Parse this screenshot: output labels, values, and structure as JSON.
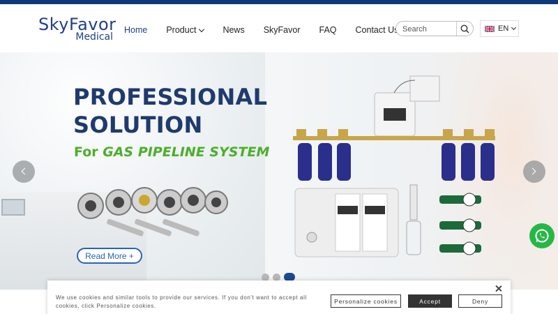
{
  "brand": {
    "logo_main": "SkyFavor",
    "logo_sub": "Medical"
  },
  "nav": {
    "items": [
      {
        "label": "Home",
        "active": true
      },
      {
        "label": "Product",
        "has_dropdown": true
      },
      {
        "label": "News"
      },
      {
        "label": "SkyFavor"
      },
      {
        "label": "FAQ"
      },
      {
        "label": "Contact Us"
      }
    ]
  },
  "search": {
    "placeholder": "Search",
    "icon": "search-icon"
  },
  "language": {
    "label": "EN",
    "flag": "uk-flag-icon"
  },
  "hero": {
    "title_line1": "PROFESSIONAL",
    "title_line2": "SOLUTION",
    "subtitle_prefix": "For ",
    "subtitle_emph": "GAS PIPELINE SYSTEM",
    "cta_label": "Read More +",
    "slides_total": 3,
    "active_slide": 3
  },
  "colors": {
    "brand_blue": "#1f3f88",
    "title_blue": "#1f3a6e",
    "accent_green": "#4caf2a",
    "cta_blue": "#2a63b8",
    "whatsapp_green": "#25b846",
    "topbar": "#0d3a7a"
  },
  "cookie_banner": {
    "text": "We use cookies and similar tools to provide our services. If you don't want to accept all cookies, click Personalize cookies.",
    "personalize_label": "Personalize cookies",
    "accept_label": "Accept",
    "deny_label": "Deny"
  }
}
